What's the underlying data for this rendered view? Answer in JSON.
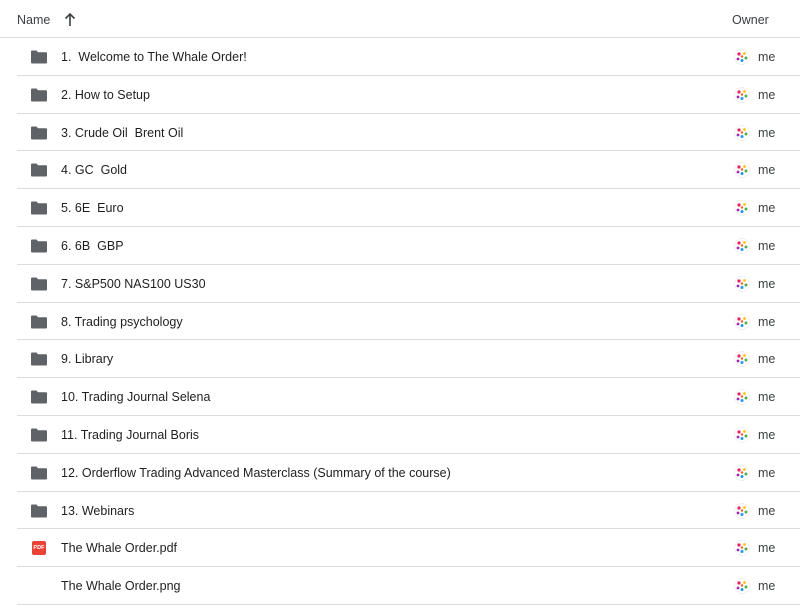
{
  "header": {
    "name_label": "Name",
    "owner_label": "Owner",
    "sort_icon": "arrow-up-icon"
  },
  "files": [
    {
      "name": "1.  Welcome to The Whale Order!",
      "type": "folder",
      "owner": "me"
    },
    {
      "name": "2. How to Setup",
      "type": "folder",
      "owner": "me"
    },
    {
      "name": "3. Crude Oil  Brent Oil",
      "type": "folder",
      "owner": "me"
    },
    {
      "name": "4. GC  Gold",
      "type": "folder",
      "owner": "me"
    },
    {
      "name": "5. 6E  Euro",
      "type": "folder",
      "owner": "me"
    },
    {
      "name": "6. 6B  GBP",
      "type": "folder",
      "owner": "me"
    },
    {
      "name": "7. S&P500 NAS100 US30",
      "type": "folder",
      "owner": "me"
    },
    {
      "name": "8. Trading psychology",
      "type": "folder",
      "owner": "me"
    },
    {
      "name": "9. Library",
      "type": "folder",
      "owner": "me"
    },
    {
      "name": "10. Trading Journal Selena",
      "type": "folder",
      "owner": "me"
    },
    {
      "name": "11. Trading Journal Boris",
      "type": "folder",
      "owner": "me"
    },
    {
      "name": "12. Orderflow Trading Advanced Masterclass (Summary of the course)",
      "type": "folder",
      "owner": "me"
    },
    {
      "name": "13. Webinars",
      "type": "folder",
      "owner": "me"
    },
    {
      "name": "The Whale Order.pdf",
      "type": "pdf",
      "owner": "me",
      "badge": "PDF"
    },
    {
      "name": "The Whale Order.png",
      "type": "image",
      "owner": "me"
    }
  ],
  "colors": {
    "folder": "#5f6368",
    "pdf": "#ea4335",
    "divider": "#dadce0"
  }
}
